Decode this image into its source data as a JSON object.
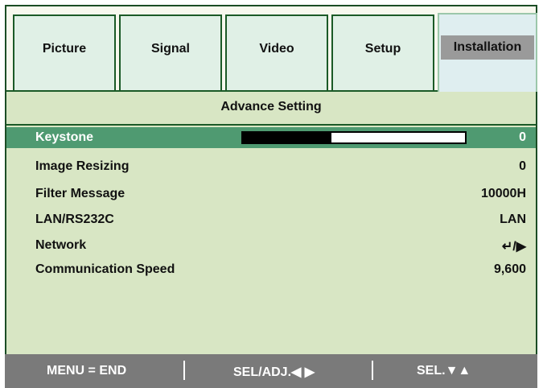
{
  "tabs": [
    {
      "label": "Picture",
      "active": false
    },
    {
      "label": "Signal",
      "active": false
    },
    {
      "label": "Video",
      "active": false
    },
    {
      "label": "Setup",
      "active": false
    },
    {
      "label": "Installation",
      "active": true
    }
  ],
  "section_title": "Advance Setting",
  "rows": [
    {
      "label": "Keystone",
      "value": "0",
      "selected": true,
      "level_fraction": 0.4
    },
    {
      "label": "Image Resizing",
      "value": "0"
    },
    {
      "label": "Filter Message",
      "value": "10000H"
    },
    {
      "label": "LAN/RS232C",
      "value": "LAN"
    },
    {
      "label": "Network",
      "value": "↵/▶"
    },
    {
      "label": "Communication Speed",
      "value": "9,600"
    }
  ],
  "footer": {
    "menu": "MENU = END",
    "sel_adj": "SEL/ADJ.◀ ▶",
    "sel": "SEL.▼▲"
  },
  "colors": {
    "border": "#1b5a27",
    "selected_row": "#4f9a71",
    "panel": "#d8e6c4",
    "footer": "#7a7a7a"
  }
}
